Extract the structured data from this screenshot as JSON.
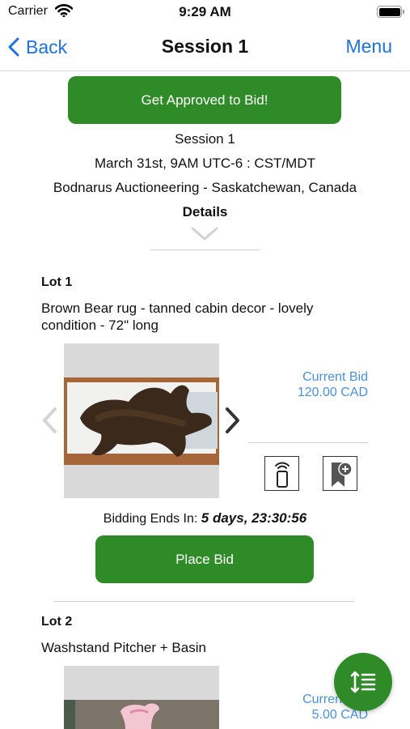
{
  "status_bar": {
    "carrier": "Carrier",
    "time": "9:29 AM"
  },
  "nav": {
    "back_label": "Back",
    "title": "Session 1",
    "menu_label": "Menu"
  },
  "approve_button": "Get Approved to Bid!",
  "session": {
    "name": "Session 1",
    "date": "March 31st, 9AM UTC-6 : CST/MDT",
    "location": "Bodnarus Auctioneering - Saskatchewan, Canada",
    "details_label": "Details"
  },
  "lots": [
    {
      "number": "Lot 1",
      "title": "Brown Bear rug - tanned cabin decor - lovely condition - 72\" long",
      "current_bid_label": "Current Bid",
      "current_bid_value": "120.00 CAD",
      "ends_label": "Bidding Ends In:",
      "ends_value": "5 days, 23:30:56",
      "place_bid_label": "Place Bid",
      "image": "bear-rug-photo"
    },
    {
      "number": "Lot 2",
      "title": "Washstand Pitcher + Basin",
      "current_bid_label": "Current Bid",
      "current_bid_value": "5.00 CAD",
      "image": "pitcher-basin-photo"
    }
  ],
  "colors": {
    "accent_green": "#2e8b28",
    "link_blue": "#1a73e0",
    "bid_blue": "#4a90e2"
  },
  "icons": [
    "wifi-icon",
    "battery-icon",
    "chevron-left-icon",
    "chevron-down-icon",
    "remote-bid-icon",
    "watchlist-add-icon",
    "sort-icon"
  ]
}
